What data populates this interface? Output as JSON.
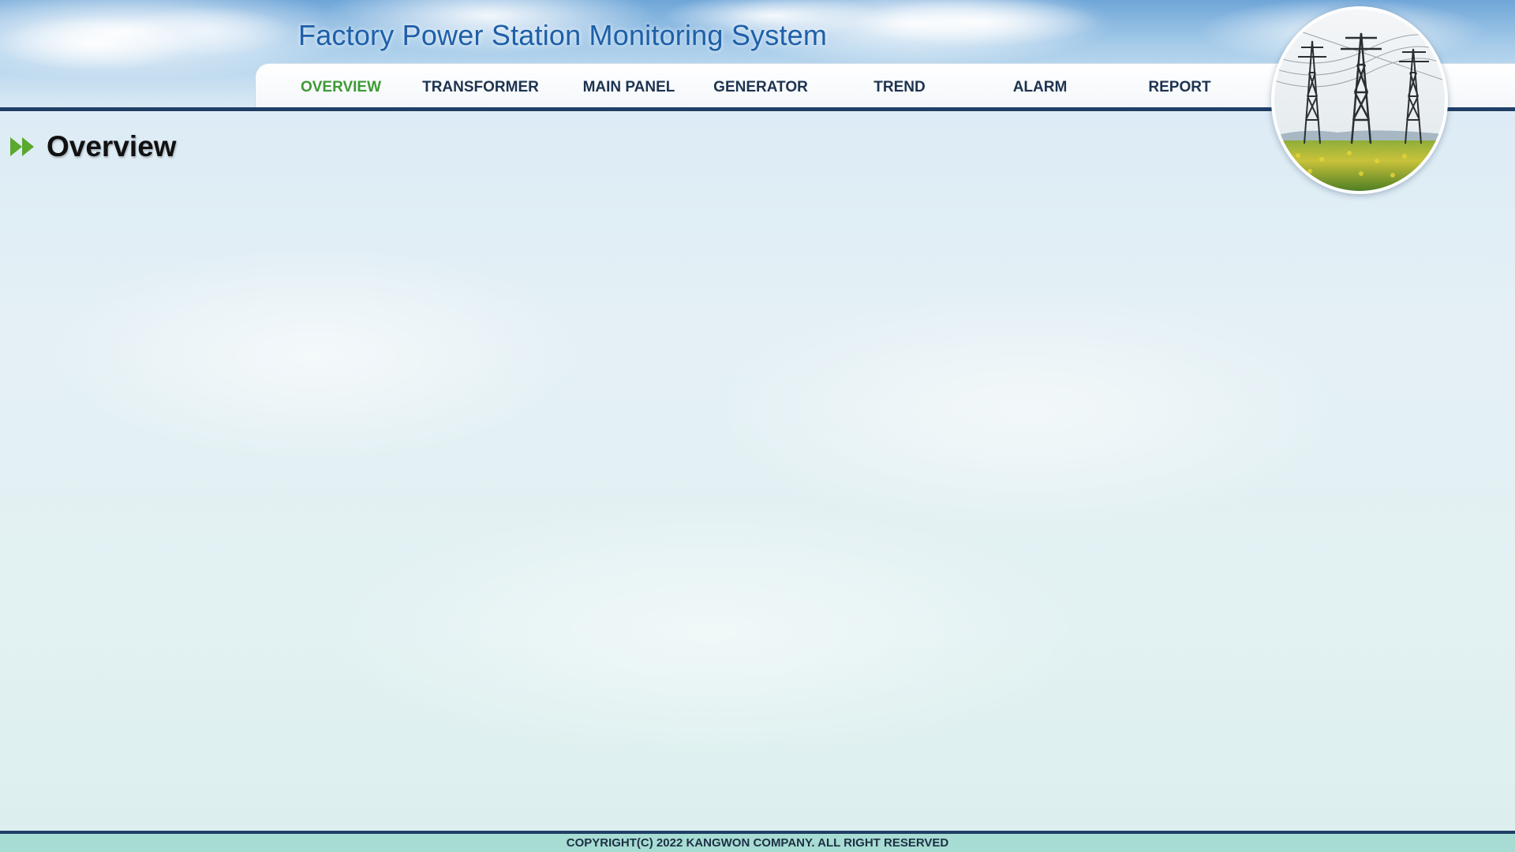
{
  "header": {
    "title": "Factory Power Station Monitoring System"
  },
  "nav": {
    "items": [
      {
        "label": "OVERVIEW",
        "active": true
      },
      {
        "label": "TRANSFORMER",
        "active": false
      },
      {
        "label": "MAIN PANEL",
        "active": false
      },
      {
        "label": "GENERATOR",
        "active": false
      },
      {
        "label": "TREND",
        "active": false
      },
      {
        "label": "ALARM",
        "active": false
      },
      {
        "label": "REPORT",
        "active": false
      }
    ],
    "active_color": "#3e9a35",
    "text_color": "#1d3350"
  },
  "logo": {
    "icon": "power-transmission-tower-icon"
  },
  "main": {
    "heading_icon": "double-arrow-right-icon",
    "heading": "Overview"
  },
  "footer": {
    "copyright": "COPYRIGHT(C) 2022 KANGWON COMPANY. ALL RIGHT RESERVED"
  },
  "colors": {
    "title": "#1e5fa8",
    "rule": "#1f3f66",
    "footer_bg": "#a7dcd2",
    "accent_green": "#5aa82e"
  }
}
